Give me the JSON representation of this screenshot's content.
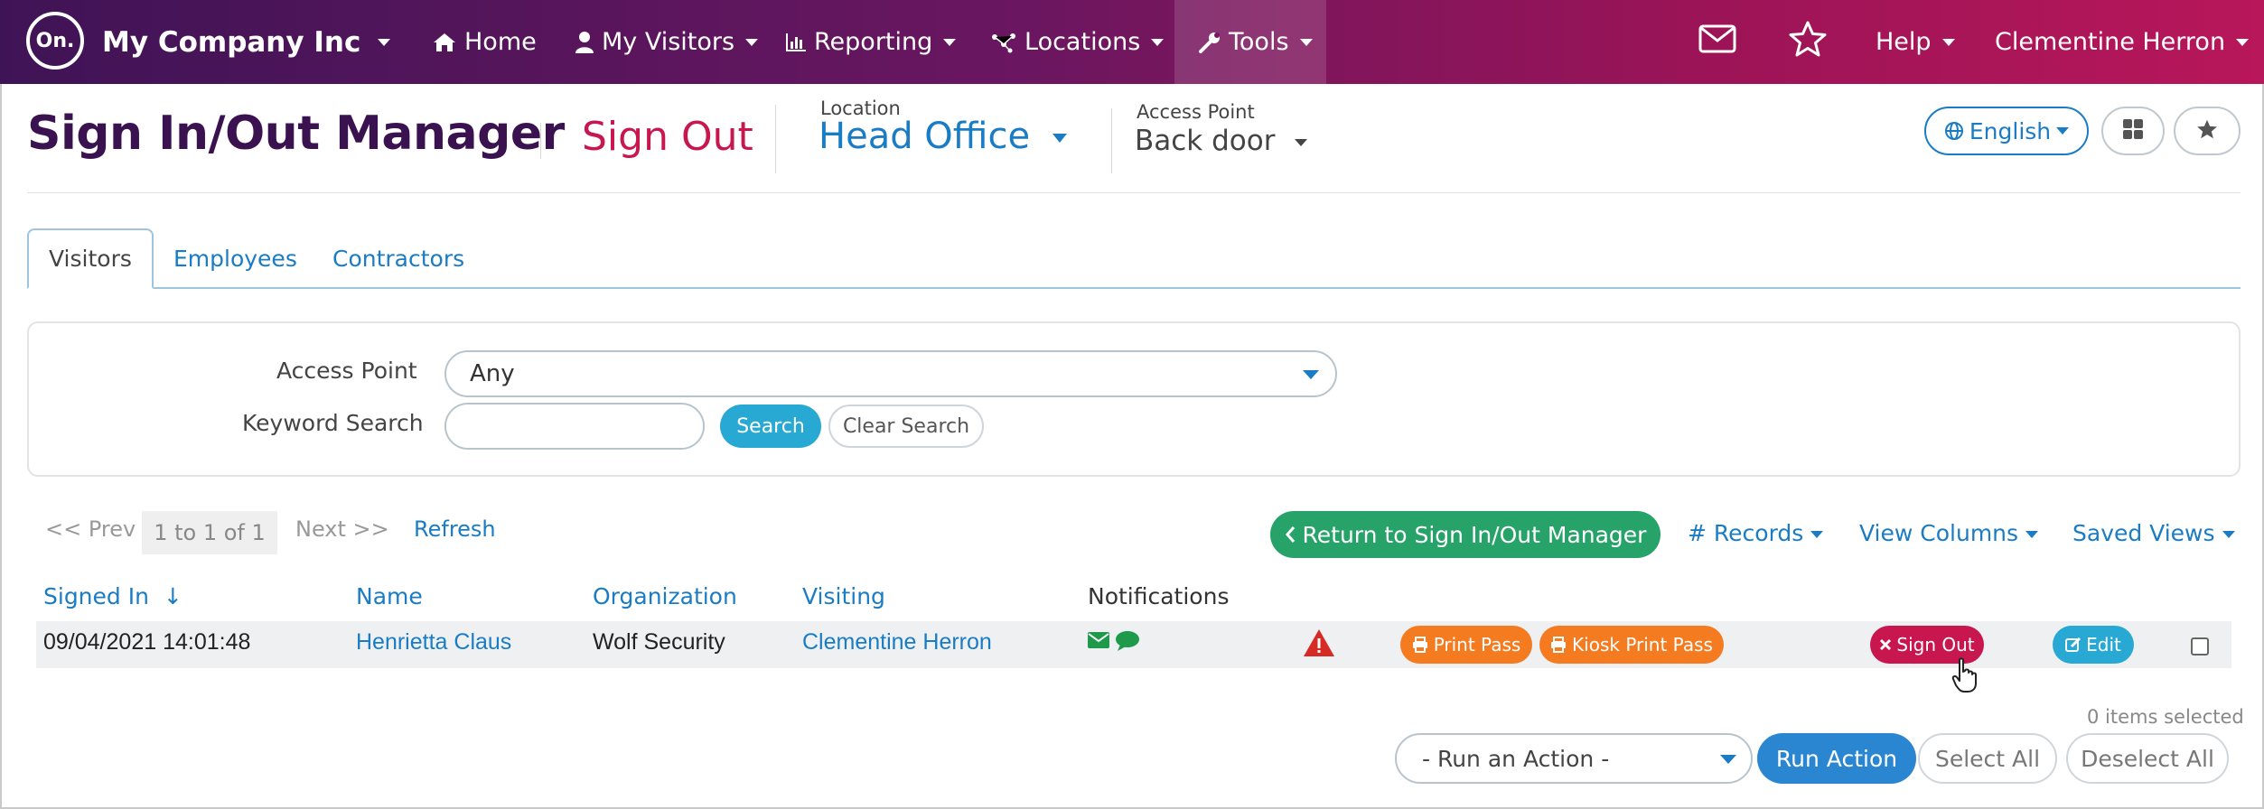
{
  "nav": {
    "logo": "On.",
    "company": "My Company Inc",
    "home": "Home",
    "my_visitors": "My Visitors",
    "reporting": "Reporting",
    "locations": "Locations",
    "tools": "Tools",
    "help": "Help",
    "user": "Clementine Herron"
  },
  "header": {
    "title": "Sign In/Out Manager",
    "mode": "Sign Out",
    "location_label": "Location",
    "location_value": "Head Office",
    "access_point_label": "Access Point",
    "access_point_value": "Back door",
    "language": "English"
  },
  "tabs": [
    "Visitors",
    "Employees",
    "Contractors"
  ],
  "search": {
    "access_point_label": "Access Point",
    "access_point_value": "Any",
    "keyword_label": "Keyword Search",
    "keyword_value": "",
    "search_button": "Search",
    "clear_button": "Clear Search"
  },
  "pager": {
    "prev": "<< Prev",
    "range": "1 to 1 of 1",
    "next": "Next >>",
    "refresh": "Refresh"
  },
  "toolbar": {
    "return": "Return to Sign In/Out Manager",
    "records": "# Records",
    "view_columns": "View Columns",
    "saved_views": "Saved Views"
  },
  "table": {
    "headers": {
      "signed_in": "Signed In",
      "sort_indicator": "↓",
      "name": "Name",
      "organization": "Organization",
      "visiting": "Visiting",
      "notifications": "Notifications"
    },
    "rows": [
      {
        "signed_in": "09/04/2021 14:01:48",
        "name": "Henrietta Claus",
        "organization": "Wolf Security",
        "visiting": "Clementine Herron",
        "print_pass": "Print Pass",
        "kiosk_print_pass": "Kiosk Print Pass",
        "sign_out": "Sign Out",
        "edit": "Edit"
      }
    ]
  },
  "footer": {
    "items_selected": "0 items selected",
    "run_action_placeholder": "- Run an Action -",
    "run_action": "Run Action",
    "select_all": "Select All",
    "deselect_all": "Deselect All"
  },
  "colors": {
    "nav_start": "#3f1456",
    "nav_end": "#b8175a",
    "title": "#3a1250",
    "sign_out_red": "#c8164f",
    "link_blue": "#1a7cc4",
    "return_green": "#27a36a",
    "print_orange": "#f47b20",
    "run_action_blue": "#2a86d1"
  },
  "icons": [
    "home-icon",
    "user-icon",
    "chart-icon",
    "locations-icon",
    "wrench-icon",
    "envelope-icon",
    "star-icon",
    "globe-icon",
    "grid-icon",
    "printer-icon",
    "warning-icon",
    "chat-icon",
    "times-icon",
    "edit-icon",
    "chevron-left-icon"
  ]
}
